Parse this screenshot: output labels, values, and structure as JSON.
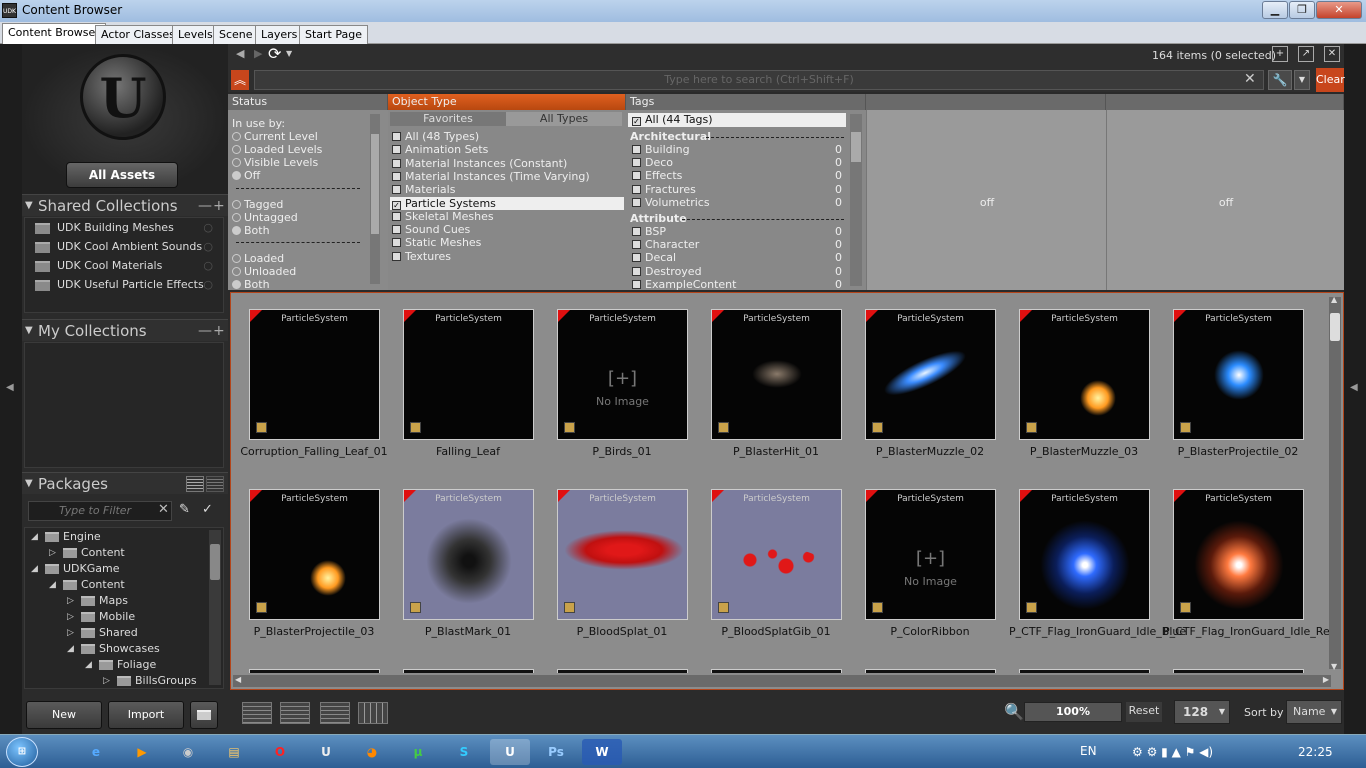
{
  "window": {
    "title": "Content Browser",
    "app_badge": "UDK"
  },
  "tabs": [
    "Content Browser",
    "Actor Classes",
    "Levels",
    "Scene",
    "Layers",
    "Start Page"
  ],
  "left": {
    "all_assets": "All Assets",
    "shared_collections_title": "Shared Collections",
    "shared_collections": [
      "UDK Building Meshes",
      "UDK Cool Ambient Sounds",
      "UDK Cool Materials",
      "UDK Useful Particle Effects"
    ],
    "my_collections_title": "My Collections",
    "packages_title": "Packages",
    "filter_placeholder": "Type to Filter",
    "tree": [
      {
        "label": "Engine",
        "depth": 0,
        "exp": "◢"
      },
      {
        "label": "Content",
        "depth": 1,
        "exp": "▷"
      },
      {
        "label": "UDKGame",
        "depth": 0,
        "exp": "◢"
      },
      {
        "label": "Content",
        "depth": 1,
        "exp": "◢"
      },
      {
        "label": "Maps",
        "depth": 2,
        "exp": "▷"
      },
      {
        "label": "Mobile",
        "depth": 2,
        "exp": "▷"
      },
      {
        "label": "Shared",
        "depth": 2,
        "exp": "▷"
      },
      {
        "label": "Showcases",
        "depth": 2,
        "exp": "◢"
      },
      {
        "label": "Foliage",
        "depth": 3,
        "exp": "◢"
      },
      {
        "label": "BillsGroups",
        "depth": 4,
        "exp": "▷"
      }
    ],
    "new_button": "New",
    "import_button": "Import"
  },
  "top": {
    "items_count": "164 items (0 selected)",
    "search_placeholder": "Type here to search  (Ctrl+Shift+F)",
    "clear": "Clear"
  },
  "status": {
    "title": "Status",
    "in_use_label": "In use by:",
    "group1": [
      {
        "label": "Current Level",
        "on": false
      },
      {
        "label": "Loaded Levels",
        "on": false
      },
      {
        "label": "Visible Levels",
        "on": false
      },
      {
        "label": "Off",
        "on": true
      }
    ],
    "group2": [
      {
        "label": "Tagged",
        "on": false
      },
      {
        "label": "Untagged",
        "on": false
      },
      {
        "label": "Both",
        "on": true
      }
    ],
    "group3": [
      {
        "label": "Loaded",
        "on": false
      },
      {
        "label": "Unloaded",
        "on": false
      },
      {
        "label": "Both",
        "on": true
      }
    ]
  },
  "object_type": {
    "title": "Object Type",
    "tab_favorites": "Favorites",
    "tab_all": "All Types",
    "items": [
      {
        "label": "All (48 Types)",
        "checked": false
      },
      {
        "label": "Animation Sets",
        "checked": false
      },
      {
        "label": "Material Instances (Constant)",
        "checked": false
      },
      {
        "label": "Material Instances (Time Varying)",
        "checked": false
      },
      {
        "label": "Materials",
        "checked": false
      },
      {
        "label": "Particle Systems",
        "checked": true
      },
      {
        "label": "Skeletal Meshes",
        "checked": false
      },
      {
        "label": "Sound Cues",
        "checked": false
      },
      {
        "label": "Static Meshes",
        "checked": false
      },
      {
        "label": "Textures",
        "checked": false
      }
    ]
  },
  "tags": {
    "title": "Tags",
    "all": "All (44 Tags)",
    "architectural_title": "Architectural",
    "architectural": [
      {
        "label": "Building",
        "count": "0"
      },
      {
        "label": "Deco",
        "count": "0"
      },
      {
        "label": "Effects",
        "count": "0"
      },
      {
        "label": "Fractures",
        "count": "0"
      },
      {
        "label": "Volumetrics",
        "count": "0"
      }
    ],
    "attribute_title": "Attribute",
    "attribute": [
      {
        "label": "BSP",
        "count": "0"
      },
      {
        "label": "Character",
        "count": "0"
      },
      {
        "label": "Decal",
        "count": "0"
      },
      {
        "label": "Destroyed",
        "count": "0"
      },
      {
        "label": "ExampleContent",
        "count": "0"
      }
    ],
    "col4": "off",
    "col5": "off"
  },
  "assets": [
    {
      "type": "ParticleSystem",
      "name": "Corruption_Falling_Leaf_01",
      "bg": "dark",
      "fx": "none"
    },
    {
      "type": "ParticleSystem",
      "name": "Falling_Leaf",
      "bg": "dark",
      "fx": "none"
    },
    {
      "type": "ParticleSystem",
      "name": "P_Birds_01",
      "bg": "dark",
      "fx": "noimage",
      "noimage_text": "No Image"
    },
    {
      "type": "ParticleSystem",
      "name": "P_BlasterHit_01",
      "bg": "dark",
      "fx": "smoke"
    },
    {
      "type": "ParticleSystem",
      "name": "P_BlasterMuzzle_02",
      "bg": "dark",
      "fx": "bluestreak"
    },
    {
      "type": "ParticleSystem",
      "name": "P_BlasterMuzzle_03",
      "bg": "dark",
      "fx": "fire"
    },
    {
      "type": "ParticleSystem",
      "name": "P_BlasterProjectile_02",
      "bg": "dark",
      "fx": "blueball"
    },
    {
      "type": "ParticleSystem",
      "name": "P_BlasterProjectile_03",
      "bg": "dark",
      "fx": "fire"
    },
    {
      "type": "ParticleSystem",
      "name": "P_BlastMark_01",
      "bg": "light",
      "fx": "blastmark"
    },
    {
      "type": "ParticleSystem",
      "name": "P_BloodSplat_01",
      "bg": "light",
      "fx": "blood"
    },
    {
      "type": "ParticleSystem",
      "name": "P_BloodSplatGib_01",
      "bg": "light",
      "fx": "blooddots"
    },
    {
      "type": "ParticleSystem",
      "name": "P_ColorRibbon",
      "bg": "dark",
      "fx": "noimage",
      "noimage_text": "No Image"
    },
    {
      "type": "ParticleSystem",
      "name": "P_CTF_Flag_IronGuard_Idle_Blue",
      "bg": "dark",
      "fx": "blueglow"
    },
    {
      "type": "ParticleSystem",
      "name": "P_CTF_Flag_IronGuard_Idle_Red",
      "bg": "dark",
      "fx": "redglow"
    }
  ],
  "bottom": {
    "zoom": "100%",
    "reset": "Reset",
    "size": "128",
    "sort_label": "Sort by",
    "sort_value": "Name"
  },
  "taskbar": {
    "lang": "EN",
    "time": "22:25"
  },
  "colors": {
    "accent": "#c8461c"
  }
}
